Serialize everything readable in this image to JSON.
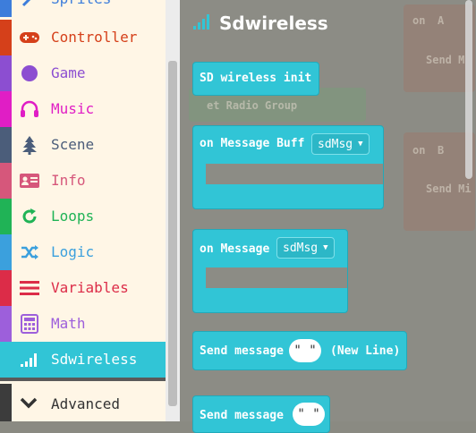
{
  "menu": {
    "items": [
      {
        "label": "Sprites",
        "color": "#3d7ddb",
        "icon": "sprites-icon"
      },
      {
        "label": "Controller",
        "color": "#d5401a",
        "icon": "gamepad-icon"
      },
      {
        "label": "Game",
        "color": "#8c4ed1",
        "icon": "circle-icon"
      },
      {
        "label": "Music",
        "color": "#e01ec5",
        "icon": "headphones-icon"
      },
      {
        "label": "Scene",
        "color": "#4b5d7a",
        "icon": "tree-icon"
      },
      {
        "label": "Info",
        "color": "#d6577b",
        "icon": "id-card-icon"
      },
      {
        "label": "Loops",
        "color": "#20b356",
        "icon": "loop-icon"
      },
      {
        "label": "Logic",
        "color": "#3ba0dd",
        "icon": "shuffle-icon"
      },
      {
        "label": "Variables",
        "color": "#dc2c48",
        "icon": "list-icon"
      },
      {
        "label": "Math",
        "color": "#9d5fdb",
        "icon": "calculator-icon"
      },
      {
        "label": "Sdwireless",
        "color": "#31c5d6",
        "icon": "signal-icon"
      }
    ],
    "advanced": {
      "label": "Advanced",
      "icon": "chevron-down-icon"
    }
  },
  "flyout": {
    "title": "Sdwireless",
    "blocks": {
      "init": "SD wireless init",
      "on_buff_label": "on Message Buff",
      "on_buff_var": "sdMsg",
      "on_msg_label": "on Message",
      "on_msg_var": "sdMsg",
      "send_newline_label": "Send message",
      "send_newline_value": "\" \"",
      "send_newline_suffix": "(New Line)",
      "send_label": "Send message",
      "send_value": "\" \""
    }
  },
  "background": {
    "ghost_radio": "et Radio Group",
    "ghost_on_a": "on",
    "ghost_a": "A",
    "ghost_send_a": "Send M",
    "ghost_on_b": "on",
    "ghost_b": "B",
    "ghost_send_b": "Send Mi"
  }
}
